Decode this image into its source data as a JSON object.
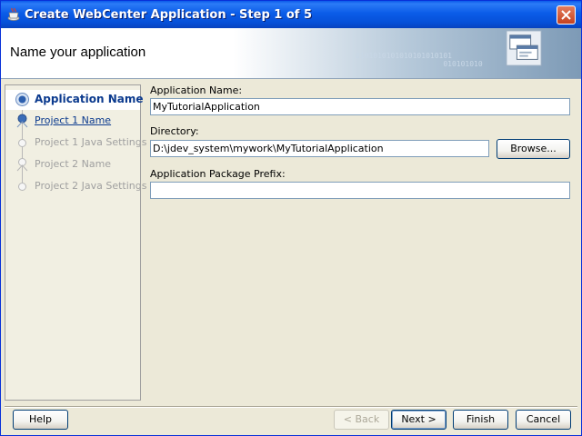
{
  "window": {
    "title": "Create WebCenter Application - Step 1 of 5"
  },
  "header": {
    "title": "Name your application",
    "decor_text": "0101010101010101010101\n                    010101010"
  },
  "nav": {
    "items": [
      {
        "label": "Application Name",
        "state": "active"
      },
      {
        "label": "Project 1 Name",
        "state": "link"
      },
      {
        "label": "Project 1 Java Settings",
        "state": "disabled"
      },
      {
        "label": "Project 2 Name",
        "state": "disabled"
      },
      {
        "label": "Project 2 Java Settings",
        "state": "disabled"
      }
    ]
  },
  "form": {
    "app_name_label": "Application Name:",
    "app_name_value": "MyTutorialApplication",
    "directory_label": "Directory:",
    "directory_value": "D:\\jdev_system\\mywork\\MyTutorialApplication",
    "browse_label": "Browse...",
    "prefix_label": "Application Package Prefix:",
    "prefix_value": ""
  },
  "buttons": {
    "help": "Help",
    "back": "< Back",
    "next": "Next >",
    "finish": "Finish",
    "cancel": "Cancel"
  },
  "colors": {
    "titlebar": "#0A5AE9",
    "active_nav_text": "#0B3A8E",
    "disabled_text": "#A0A0A0"
  }
}
